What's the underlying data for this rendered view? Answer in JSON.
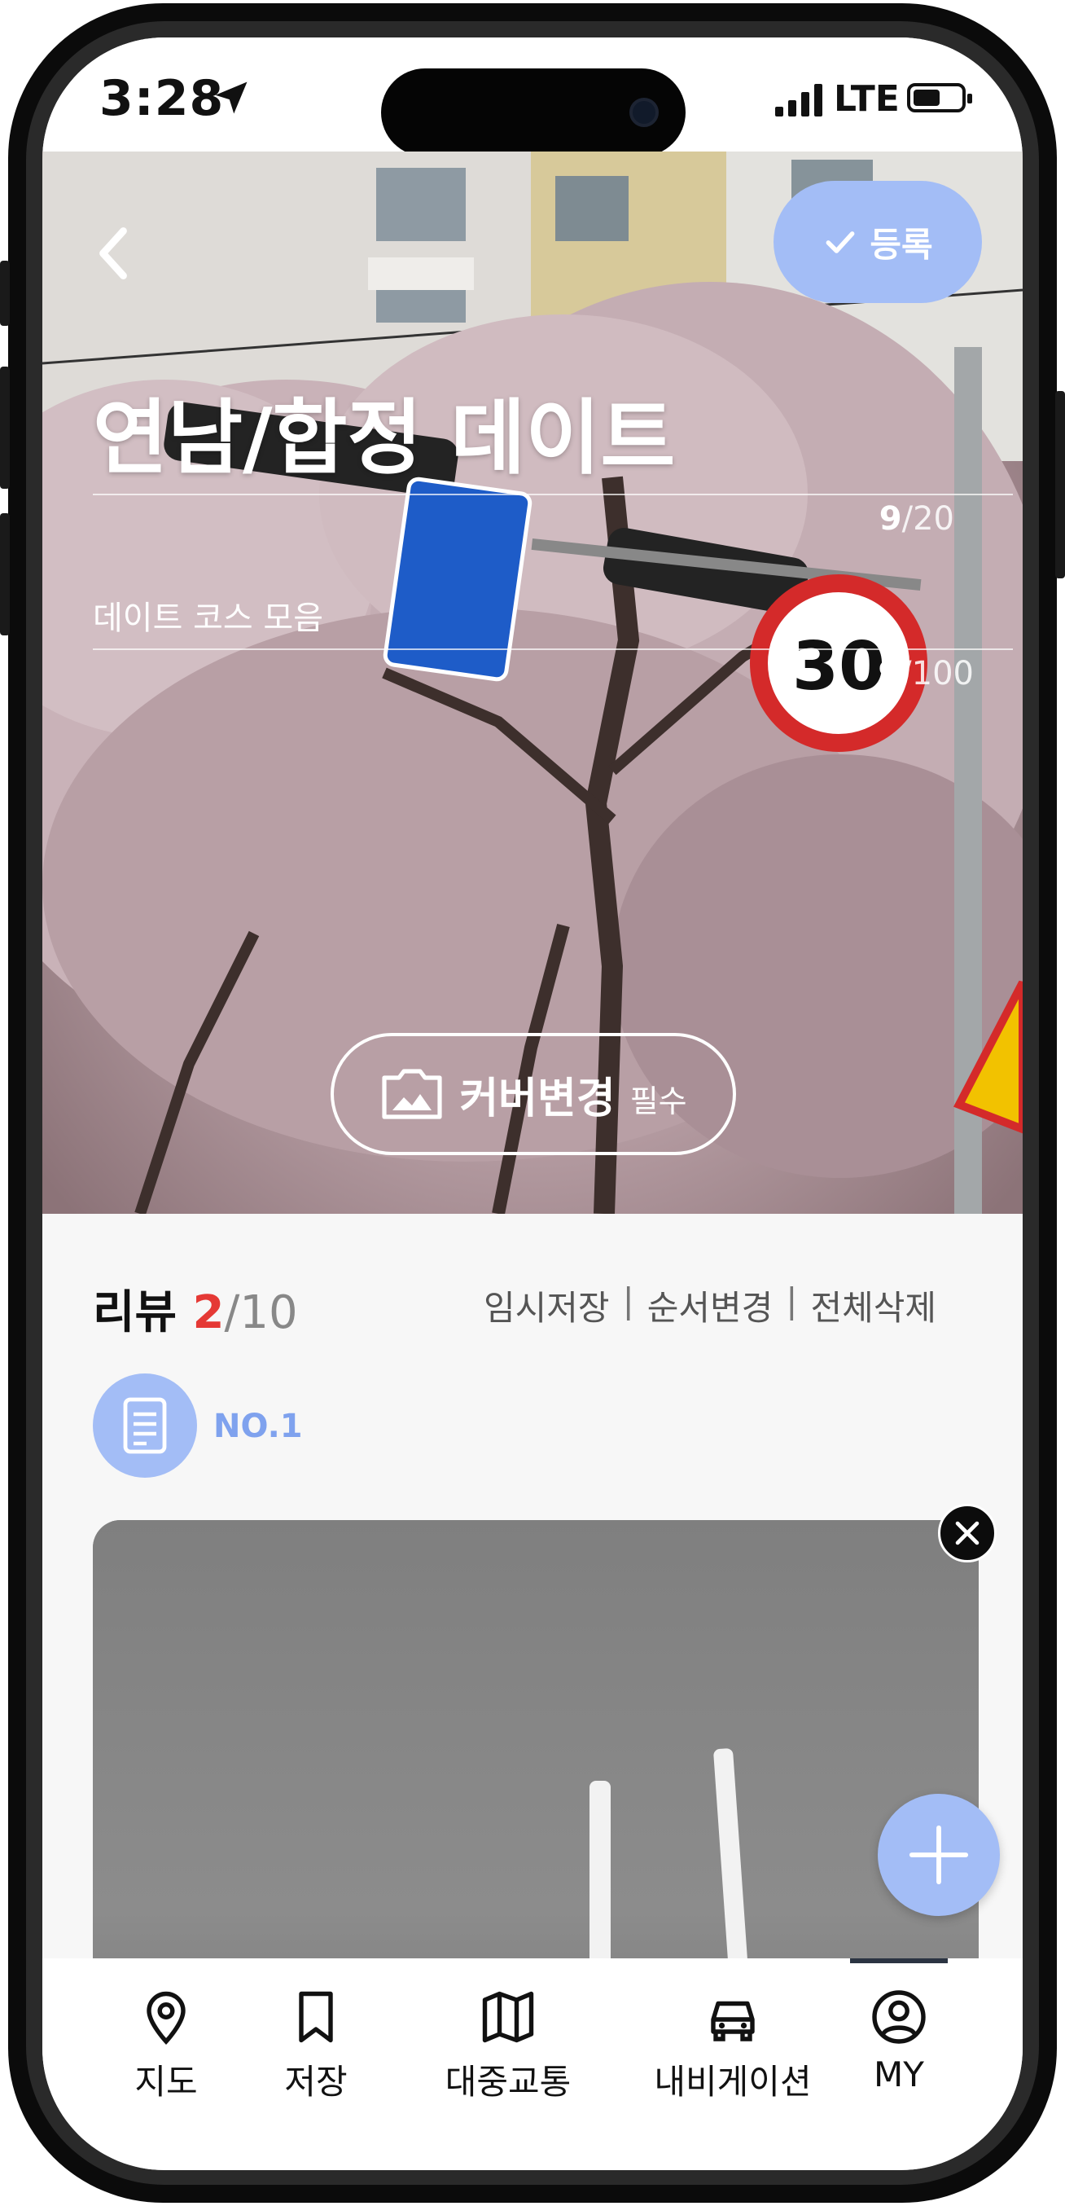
{
  "status_bar": {
    "time": "3:28",
    "network": "LTE"
  },
  "header": {
    "register_label": "등록",
    "title": "연남/합정 데이트",
    "title_count": "9",
    "title_max": "/20",
    "subtitle": "데이트 코스 모음",
    "subtitle_count": "9",
    "subtitle_max": "/100",
    "cover_button_label": "커버변경",
    "cover_button_required": "필수"
  },
  "reviews": {
    "label": "리뷰",
    "current": "2",
    "total": "/10",
    "actions": [
      "임시저장",
      "순서변경",
      "전체삭제"
    ],
    "separator": "|",
    "item_label": "NO.1"
  },
  "tabbar": {
    "items": [
      {
        "label": "지도",
        "icon": "map-pin-icon"
      },
      {
        "label": "저장",
        "icon": "bookmark-icon"
      },
      {
        "label": "대중교통",
        "icon": "folded-map-icon"
      },
      {
        "label": "내비게이션",
        "icon": "car-icon"
      },
      {
        "label": "MY",
        "icon": "user-circle-icon"
      }
    ],
    "active_index": 4
  },
  "colors": {
    "accent": "#a3bdf6",
    "count_red": "#e53935",
    "no_label": "#7fa2ee"
  }
}
